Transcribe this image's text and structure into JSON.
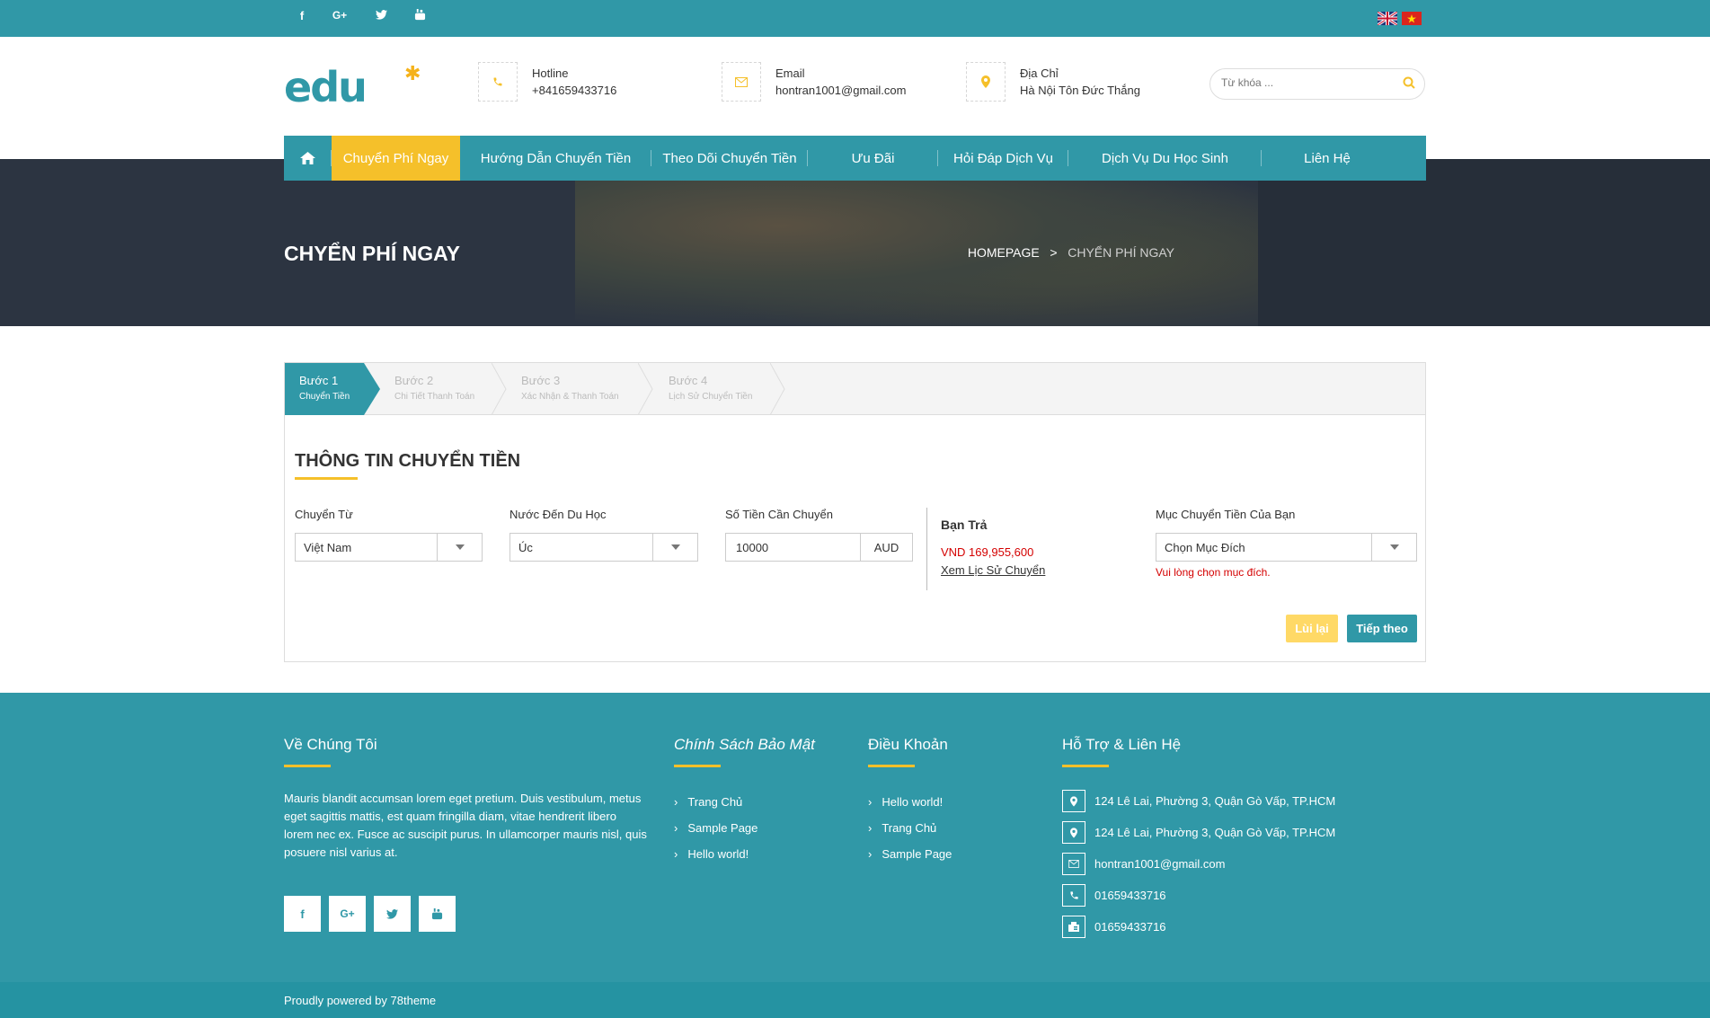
{
  "header": {
    "hotline_label": "Hotline",
    "hotline_value": "+841659433716",
    "email_label": "Email",
    "email_value": "hontran1001@gmail.com",
    "address_label": "Địa Chỉ",
    "address_value": "Hà Nội Tôn Đức Thắng",
    "search_placeholder": "Từ khóa ..."
  },
  "nav": {
    "items": [
      "Chuyển Phí Ngay",
      "Hướng Dẫn Chuyển Tiền",
      "Theo Dõi Chuyển Tiền",
      "Ưu Đãi",
      "Hỏi Đáp Dịch Vụ",
      "Dịch Vụ Du Học Sinh",
      "Liên Hệ"
    ]
  },
  "hero": {
    "title": "CHYỂN PHÍ NGAY",
    "breadcrumb_home": "HOMEPAGE",
    "breadcrumb_sep": ">",
    "breadcrumb_current": "CHYỂN PHÍ NGAY"
  },
  "steps": [
    {
      "title": "Bước 1",
      "sub": "Chuyển Tiền"
    },
    {
      "title": "Bước 2",
      "sub": "Chi Tiết Thanh Toán"
    },
    {
      "title": "Bước 3",
      "sub": "Xác Nhận & Thanh Toán"
    },
    {
      "title": "Bước 4",
      "sub": "Lịch Sử Chuyển Tiền"
    }
  ],
  "form": {
    "heading": "THÔNG TIN CHUYỂN TIỀN",
    "from_label": "Chuyển Từ",
    "from_value": "Việt Nam",
    "dest_label": "Nước Đến Du Học",
    "dest_value": "Úc",
    "amount_label": "Số Tiền Cần Chuyển",
    "amount_value": "10000",
    "amount_currency": "AUD",
    "pay_label": "Bạn Trả",
    "pay_value": "VND 169,955,600",
    "history_link": "Xem Lịc Sử Chuyển",
    "purpose_label": "Mục Chuyển Tiền Của Bạn",
    "purpose_value": "Chọn Mục Đích",
    "purpose_error": "Vui lòng chọn mục đích.",
    "back_button": "Lùi lại",
    "next_button": "Tiếp theo"
  },
  "footer": {
    "about_title": "Về Chúng Tôi",
    "about_text": "Mauris blandit accumsan lorem eget pretium. Duis vestibulum, metus eget sagittis mattis, est quam fringilla diam, vitae hendrerit libero lorem nec ex. Fusce ac suscipit purus. In ullamcorper mauris nisl, quis posuere nisl varius at.",
    "privacy_title": "Chính Sách Bảo Mật",
    "privacy_links": [
      "Trang Chủ",
      "Sample Page",
      "Hello world!"
    ],
    "terms_title": "Điều Khoản",
    "terms_links": [
      "Hello world!",
      "Trang Chủ",
      "Sample Page"
    ],
    "support_title": "Hỗ Trợ & Liên Hệ",
    "contacts": [
      "124 Lê Lai, Phường 3, Quận Gò Vấp, TP.HCM",
      "124 Lê Lai, Phường 3, Quận Gò Vấp, TP.HCM",
      "hontran1001@gmail.com",
      "01659433716",
      "01659433716"
    ],
    "copyright": "Proudly powered by 78theme"
  },
  "social_icons": [
    "facebook-icon",
    "google-plus-icon",
    "twitter-icon",
    "youtube-icon"
  ],
  "colors": {
    "primary": "#3098a7",
    "accent": "#f5c02a",
    "error": "#d40000",
    "hero": "#2c3441"
  }
}
